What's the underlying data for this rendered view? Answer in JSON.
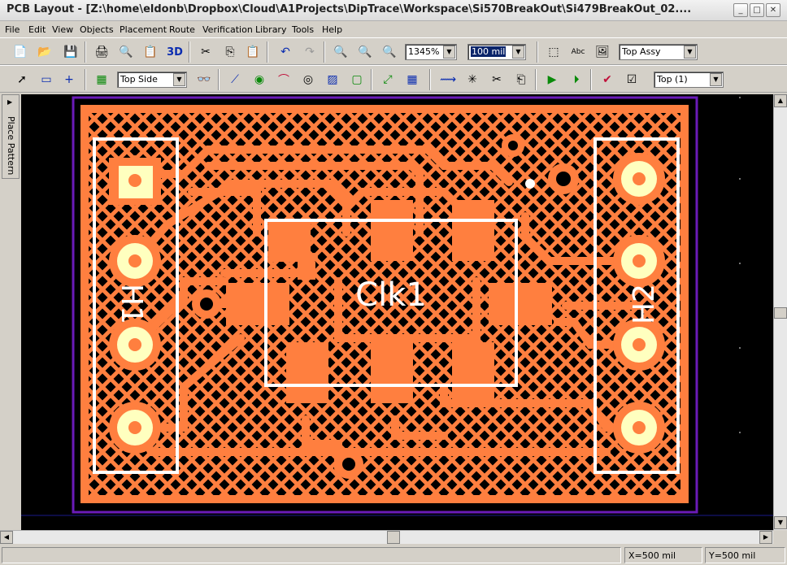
{
  "window": {
    "title": "PCB Layout - [Z:\\home\\eldonb\\Dropbox\\Cloud\\A1Projects\\DipTrace\\Workspace\\Si570BreakOut\\Si479BreakOut_02...."
  },
  "menu": [
    "File",
    "Edit",
    "View",
    "Objects",
    "Placement",
    "Route",
    "Verification",
    "Library",
    "Tools",
    "Help"
  ],
  "toolbar1": {
    "zoom_value": "1345%",
    "grid_value": "100 mil",
    "layer_value": "Top Assy",
    "three_d_label": "3D"
  },
  "toolbar2": {
    "side_value": "Top Side",
    "layer_value": "Top (1)"
  },
  "side_tab": {
    "label": "Place Pattern"
  },
  "board": {
    "designators": [
      "Clk1",
      "H1",
      "H2"
    ],
    "colors": {
      "copper": "#ff7f3f",
      "background": "#000000",
      "outline": "#6a1bb8",
      "silkscreen": "#ffffff",
      "pad": "#ffffbf"
    }
  },
  "status": {
    "x": "X=500 mil",
    "y": "Y=500 mil"
  }
}
